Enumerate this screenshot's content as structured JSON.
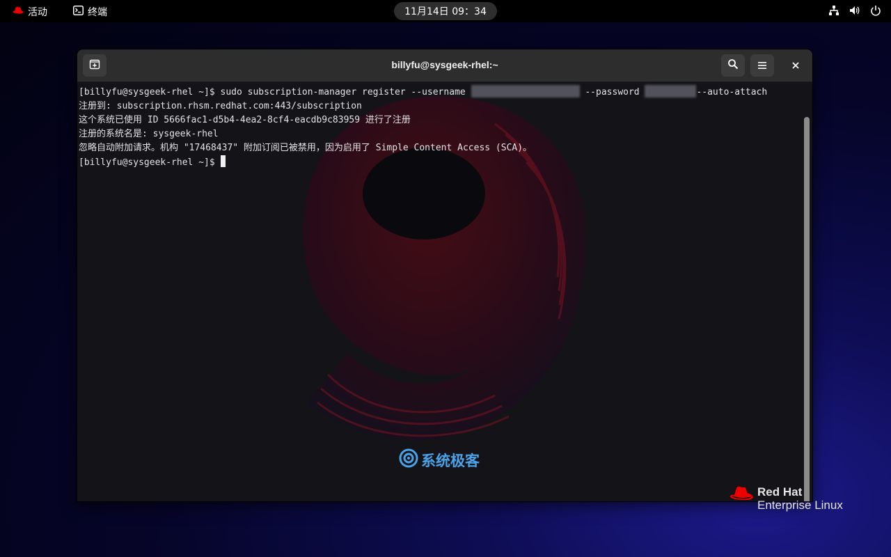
{
  "topbar": {
    "activities": "活动",
    "app_name": "终端",
    "clock": "11月14日 09：34",
    "icons": [
      "redhat-icon",
      "terminal-app-icon",
      "network-icon",
      "volume-icon",
      "power-icon"
    ]
  },
  "window": {
    "title": "billyfu@sysgeek-rhel:~",
    "buttons": [
      "new-tab-icon",
      "search-icon",
      "hamburger-menu-icon",
      "close-icon"
    ]
  },
  "terminal": {
    "line1_cmd": "[billyfu@sysgeek-rhel ~]$ sudo subscription-manager register --username ",
    "line1_pass": " --password ",
    "line1_tail": "--auto-attach",
    "line2": "注册到: subscription.rhsm.redhat.com:443/subscription",
    "line3": "这个系统已使用 ID 5666fac1-d5b4-4ea2-8cf4-eacdb9c83959 进行了注册",
    "line4": "注册的系统名是: sysgeek-rhel",
    "line5": "忽略自动附加请求。机构 \"17468437\" 附加订阅已被禁用，因为启用了 Simple Content Access (SCA)。",
    "prompt": "[billyfu@sysgeek-rhel ~]$ "
  },
  "watermark": "系统极客",
  "branding": {
    "line1": "Red Hat",
    "line2": "Enterprise Linux"
  },
  "colors": {
    "accent_red": "#ee0000",
    "watermark_blue": "#4aa3e8"
  }
}
